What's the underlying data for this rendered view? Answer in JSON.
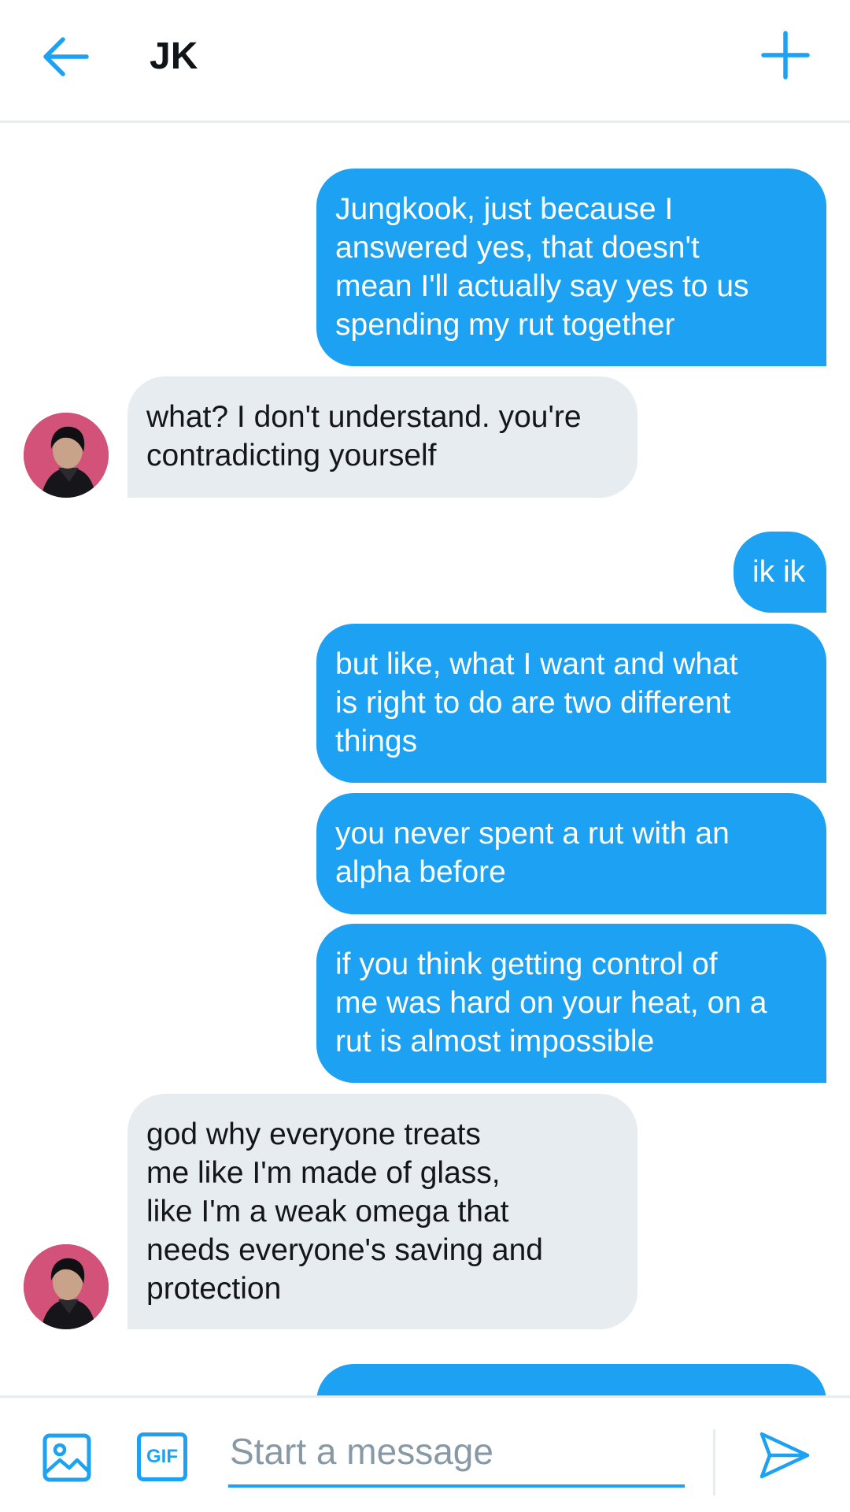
{
  "header": {
    "title": "JK"
  },
  "messages": [
    {
      "side": "sent",
      "text": "Jungkook, just because I\nanswered yes, that doesn't\nmean I'll actually say yes to us\nspending my rut together"
    },
    {
      "side": "received",
      "text": "what? I don't understand. you're\ncontradicting yourself"
    },
    {
      "side": "sent",
      "text": "ik ik"
    },
    {
      "side": "sent",
      "text": "but like, what I want and what\nis right to do are two different\nthings"
    },
    {
      "side": "sent",
      "text": "you never spent a rut with an\nalpha before"
    },
    {
      "side": "sent",
      "text": "if you think getting control of\nme was hard on your heat, on a\nrut is almost impossible"
    },
    {
      "side": "received",
      "text": "god why everyone treats\nme like I'm made of glass,\nlike I'm a weak omega that\nneeds everyone's saving and\nprotection"
    },
    {
      "side": "sent",
      "text": ""
    }
  ],
  "composer": {
    "placeholder": "Start a message",
    "gif_label": "GIF"
  },
  "icons": {
    "back": "arrow-left-icon",
    "new": "plus-icon",
    "media": "image-icon",
    "gif": "gif-icon",
    "send": "send-icon"
  },
  "colors": {
    "accent": "#1da1f2",
    "received_bubble": "#e6ecf0",
    "received_text": "#14171a",
    "sent_text": "#ffffff",
    "avatar_bg": "#d2527a"
  }
}
